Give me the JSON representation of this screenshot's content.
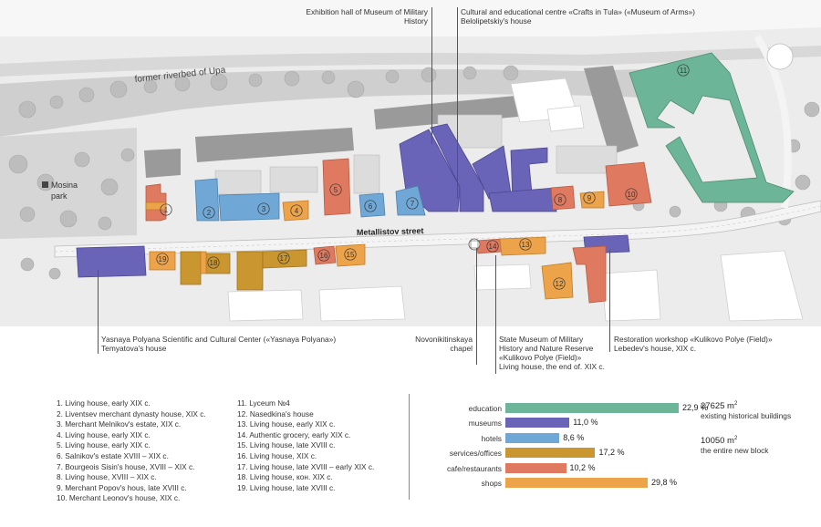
{
  "map": {
    "river_label": "former riverbed of Upa",
    "street_label": "Metallistov street",
    "park_label_1": "Mosina",
    "park_label_2": "park",
    "colors": {
      "education": "#6db598",
      "museums": "#6a64b8",
      "hotels": "#6fa8d6",
      "services": "#c9962f",
      "cafe": "#df7a60",
      "shops": "#eda34a"
    },
    "building_numbers": [
      "1",
      "2",
      "3",
      "4",
      "5",
      "6",
      "7",
      "8",
      "9",
      "10",
      "11",
      "12",
      "13",
      "14",
      "15",
      "16",
      "17",
      "18",
      "19"
    ]
  },
  "annotations": {
    "exhibition_1": "Exhibition hall of Museum of Military",
    "exhibition_2": "History",
    "crafts_1": "Cultural and educational centre «Crafts in Tula» («Museum of Arms»)",
    "crafts_2": "Belolipetskiy's house",
    "yasnaya_1": "Yasnaya Polyana Scientific and Cultural Center  («Yasnaya Polyana»)",
    "yasnaya_2": "Temyatova's house",
    "chapel_1": "Novonikitinskaya",
    "chapel_2": "chapel",
    "state_1": "State Museum of Military",
    "state_2": "History and Nature Reserve",
    "state_3": "«Kulikovo Polye (Field)»",
    "state_4": "Living house, the end of. XIX c.",
    "restoration_1": "Restoration workshop «Kulikovo Polye (Field)»",
    "restoration_2": "Lebedev's house, XIX c."
  },
  "legend": {
    "col1": [
      "1. Living house,  early XIX c.",
      "2. Liventsev merchant dynasty house, XIX c.",
      "3. Merchant Melnikov's estate, XIX c.",
      "4. Living house, early XIX c.",
      "5. Living house, early XIX c.",
      "6. Salnikov's estate  XVIII – XIX c.",
      "7. Bourgeois Sisin's house, XVIII – XIX c.",
      "8. Living house,  XVIII –  XIX c.",
      "9. Merchant Popov's hous, late XVIII c.",
      "10. Merchant Leonov's house,  XIX c."
    ],
    "col2": [
      "11. Lyceum №4",
      "12. Nasedkina's house",
      "13. Living house,  early  XIX c.",
      "14. Authentic grocery, early XIX c.",
      "15. Living house, late XVIII c.",
      "16. Living house, XIX c.",
      "17. Living house, late XVIII – early XIX c.",
      "18. Living house, кон. XIX c.",
      "19. Living house, late XVIII c."
    ]
  },
  "stats": {
    "rows": [
      {
        "label": "education",
        "value": "22,9 %",
        "pct": 22.9,
        "color": "#6db598"
      },
      {
        "label": "museums",
        "value": "11,0 %",
        "pct": 11.0,
        "color": "#6a64b8"
      },
      {
        "label": "hotels",
        "value": "8,6 %",
        "pct": 8.6,
        "color": "#6fa8d6"
      },
      {
        "label": "services/offices",
        "value": "17,2 %",
        "pct": 17.2,
        "color": "#c9962f"
      },
      {
        "label": "cafe/restaurants",
        "value": "10,2 %",
        "pct": 10.2,
        "color": "#df7a60"
      },
      {
        "label": "shops",
        "value": "29,8 %",
        "pct": 29.8,
        "color": "#eda34a"
      }
    ],
    "total1_value": "27625 m",
    "total1_sup": "2",
    "total1_desc": "existing historical buildings",
    "total2_value": "10050 m",
    "total2_sup": "2",
    "total2_desc": "the entire new block"
  }
}
